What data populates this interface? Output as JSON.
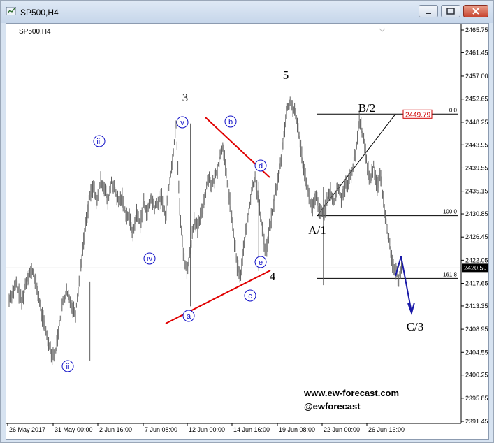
{
  "window": {
    "title": "SP500,H4",
    "buttons": [
      "minimize-button",
      "maximize-button",
      "close-button"
    ],
    "icons": {
      "minimize": "minimize-icon",
      "maximize": "maximize-icon",
      "close": "close-icon",
      "app": "chart-app-icon"
    }
  },
  "chart_data": {
    "type": "candlestick",
    "symbol_label": "SP500,H4",
    "y_ticks": [
      "2465.75",
      "2461.45",
      "2457.00",
      "2452.65",
      "2448.25",
      "2443.95",
      "2439.55",
      "2435.15",
      "2430.85",
      "2426.45",
      "2422.05",
      "2417.65",
      "2413.35",
      "2408.95",
      "2404.55",
      "2400.25",
      "2395.85",
      "2391.45"
    ],
    "ylim": [
      2391.45,
      2465.75
    ],
    "x_ticks": [
      "26 May 2017",
      "31 May 00:00",
      "2 Jun 16:00",
      "7 Jun 08:00",
      "12 Jun 00:00",
      "14 Jun 16:00",
      "19 Jun 08:00",
      "22 Jun 00:00",
      "26 Jun 16:00"
    ],
    "current_price": "2420.59",
    "marked_price": "2449.79",
    "fib_levels": [
      {
        "label": "0.0",
        "price": 2449.79
      },
      {
        "label": "100.0",
        "price": 2430.5
      },
      {
        "label": "161.8",
        "price": 2418.6
      }
    ],
    "price_path": [
      [
        0,
        2414.5
      ],
      [
        8,
        2417.5
      ],
      [
        14,
        2414
      ],
      [
        20,
        2419
      ],
      [
        26,
        2420
      ],
      [
        32,
        2416
      ],
      [
        36,
        2412
      ],
      [
        42,
        2408
      ],
      [
        48,
        2404
      ],
      [
        52,
        2405
      ],
      [
        56,
        2410
      ],
      [
        60,
        2414
      ],
      [
        64,
        2416
      ],
      [
        68,
        2414
      ],
      [
        74,
        2412
      ],
      [
        78,
        2418
      ],
      [
        82,
        2424
      ],
      [
        86,
        2430
      ],
      [
        90,
        2434
      ],
      [
        94,
        2436
      ],
      [
        98,
        2433
      ],
      [
        102,
        2437
      ],
      [
        106,
        2436
      ],
      [
        110,
        2433
      ],
      [
        114,
        2437
      ],
      [
        118,
        2435
      ],
      [
        122,
        2433
      ],
      [
        126,
        2434
      ],
      [
        130,
        2431
      ],
      [
        134,
        2430
      ],
      [
        138,
        2427
      ],
      [
        142,
        2431
      ],
      [
        146,
        2429
      ],
      [
        150,
        2433
      ],
      [
        154,
        2431
      ],
      [
        158,
        2434
      ],
      [
        162,
        2432
      ],
      [
        166,
        2433
      ],
      [
        170,
        2434
      ],
      [
        174,
        2430
      ],
      [
        178,
        2436
      ],
      [
        182,
        2441
      ],
      [
        186,
        2448
      ],
      [
        190,
        2432
      ],
      [
        194,
        2423
      ],
      [
        198,
        2420
      ],
      [
        202,
        2424
      ],
      [
        206,
        2430
      ],
      [
        210,
        2428
      ],
      [
        214,
        2431
      ],
      [
        218,
        2434
      ],
      [
        222,
        2438
      ],
      [
        226,
        2436
      ],
      [
        230,
        2438
      ],
      [
        234,
        2441
      ],
      [
        238,
        2444
      ],
      [
        242,
        2438
      ],
      [
        246,
        2433
      ],
      [
        250,
        2427
      ],
      [
        254,
        2421
      ],
      [
        258,
        2419
      ],
      [
        262,
        2426
      ],
      [
        266,
        2430
      ],
      [
        270,
        2435
      ],
      [
        274,
        2438
      ],
      [
        278,
        2433
      ],
      [
        282,
        2428
      ],
      [
        286,
        2423
      ],
      [
        290,
        2428
      ],
      [
        294,
        2432
      ],
      [
        298,
        2436
      ],
      [
        302,
        2440
      ],
      [
        306,
        2446
      ],
      [
        310,
        2451
      ],
      [
        314,
        2452
      ],
      [
        318,
        2450
      ],
      [
        322,
        2447
      ],
      [
        326,
        2442
      ],
      [
        330,
        2438
      ],
      [
        334,
        2434
      ],
      [
        338,
        2432
      ],
      [
        342,
        2434
      ],
      [
        346,
        2431
      ],
      [
        350,
        2431
      ],
      [
        354,
        2433
      ],
      [
        358,
        2435
      ],
      [
        362,
        2433
      ],
      [
        366,
        2436
      ],
      [
        370,
        2434
      ],
      [
        374,
        2436
      ],
      [
        378,
        2437
      ],
      [
        382,
        2439
      ],
      [
        386,
        2442
      ],
      [
        390,
        2449
      ],
      [
        394,
        2446
      ],
      [
        398,
        2441
      ],
      [
        402,
        2437
      ],
      [
        406,
        2440
      ],
      [
        410,
        2436
      ],
      [
        414,
        2438
      ],
      [
        418,
        2432
      ],
      [
        422,
        2427
      ],
      [
        426,
        2422
      ],
      [
        430,
        2420
      ],
      [
        434,
        2418.6
      ],
      [
        437,
        2421
      ]
    ],
    "wave_labels_numbers": [
      {
        "text": "3",
        "price": 2455,
        "x_label": "10 Jun"
      },
      {
        "text": "5",
        "price": 2457.5,
        "x_label": "19 Jun"
      },
      {
        "text": "4",
        "price": 2417,
        "x_label": "16 Jun"
      },
      {
        "text": "A/1",
        "price": 2426,
        "x_label": "21 Jun"
      },
      {
        "text": "B/2",
        "price": 2450.5,
        "x_label": "24 Jun"
      },
      {
        "text": "C/3",
        "price": 2409,
        "x_label": "28 Jun"
      }
    ],
    "wave_labels_circled": [
      {
        "text": "ii",
        "price": 2401.5
      },
      {
        "text": "iii",
        "price": 2444.5
      },
      {
        "text": "iv",
        "price": 2421.0
      },
      {
        "text": "v",
        "price": 2447.5
      },
      {
        "text": "a",
        "price": 2411.5
      },
      {
        "text": "b",
        "price": 2447.5
      },
      {
        "text": "c",
        "price": 2414.5
      },
      {
        "text": "d",
        "price": 2438.5
      },
      {
        "text": "e",
        "price": 2420.5
      }
    ],
    "grid": false,
    "legend": "none"
  },
  "watermark": {
    "line1": "www.ew-forecast.com",
    "line2": "@ewforecast"
  }
}
